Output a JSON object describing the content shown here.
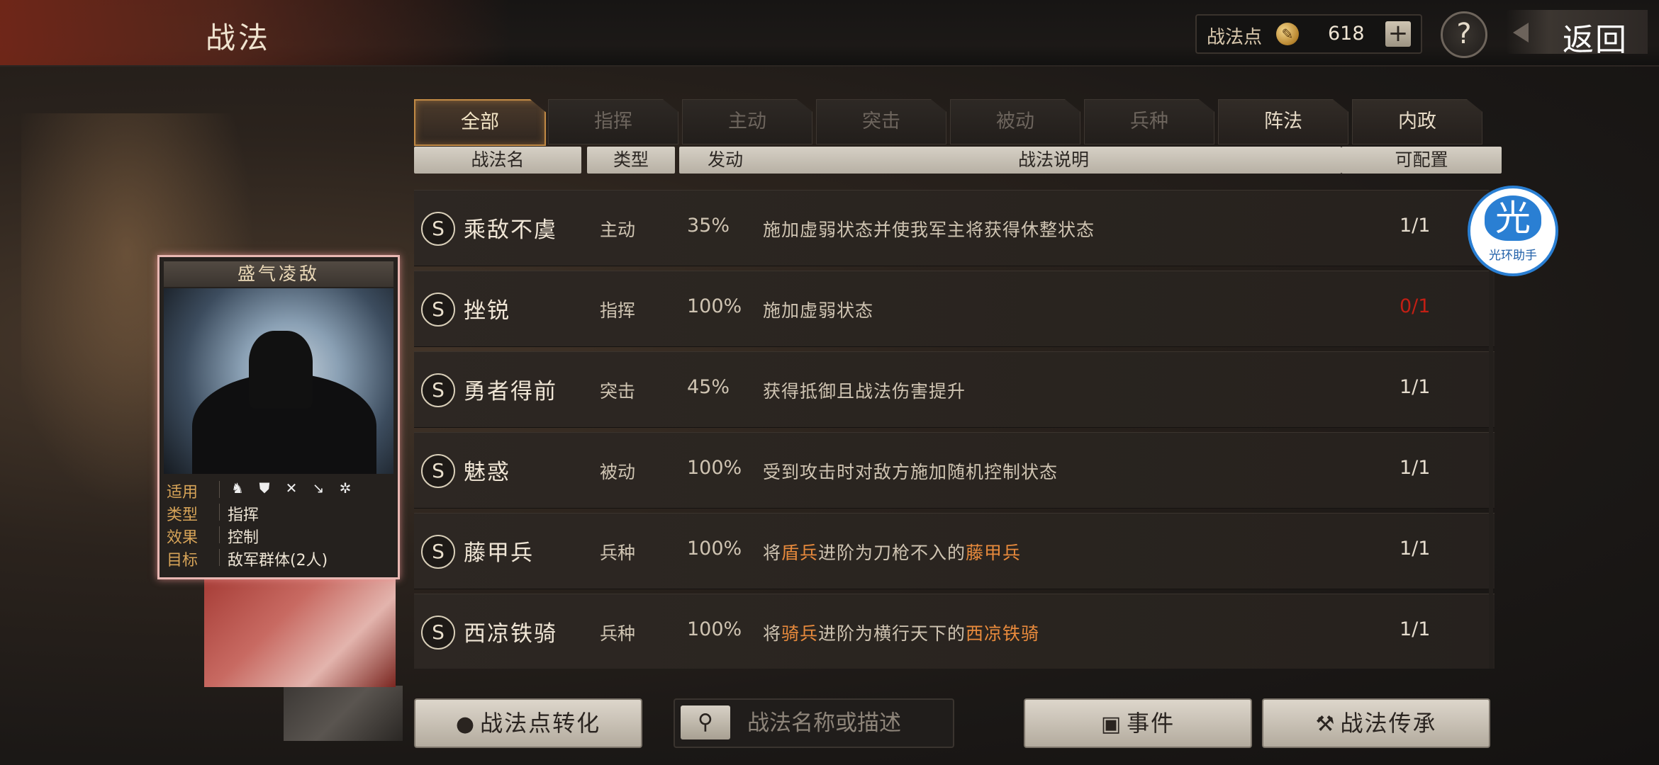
{
  "header": {
    "title": "战法",
    "points_label": "战法点",
    "points_value": "618",
    "plus_label": "+",
    "help_label": "?",
    "back_label": "返回"
  },
  "tabs": [
    {
      "label": "全部",
      "state": "active"
    },
    {
      "label": "指挥",
      "state": "dim"
    },
    {
      "label": "主动",
      "state": "dim"
    },
    {
      "label": "突击",
      "state": "dim"
    },
    {
      "label": "被动",
      "state": "dim"
    },
    {
      "label": "兵种",
      "state": "dim"
    },
    {
      "label": "阵法",
      "state": "bright"
    },
    {
      "label": "内政",
      "state": "bright"
    }
  ],
  "columns": {
    "name": "战法名",
    "type": "类型",
    "rate": "发动",
    "desc": "战法说明",
    "config": "可配置"
  },
  "rows": [
    {
      "grade": "S",
      "name": "乘敌不虞",
      "type": "主动",
      "rate": "35%",
      "desc_parts": [
        {
          "t": "施加虚弱状态并使我军主将获得休整状态"
        }
      ],
      "config": "1/1",
      "config_color": "normal"
    },
    {
      "grade": "S",
      "name": "挫锐",
      "type": "指挥",
      "rate": "100%",
      "desc_parts": [
        {
          "t": "施加虚弱状态"
        }
      ],
      "config": "0/1",
      "config_color": "red"
    },
    {
      "grade": "S",
      "name": "勇者得前",
      "type": "突击",
      "rate": "45%",
      "desc_parts": [
        {
          "t": "获得抵御且战法伤害提升"
        }
      ],
      "config": "1/1",
      "config_color": "normal"
    },
    {
      "grade": "S",
      "name": "魅惑",
      "type": "被动",
      "rate": "100%",
      "desc_parts": [
        {
          "t": "受到攻击时对敌方施加随机控制状态"
        }
      ],
      "config": "1/1",
      "config_color": "normal"
    },
    {
      "grade": "S",
      "name": "藤甲兵",
      "type": "兵种",
      "rate": "100%",
      "desc_parts": [
        {
          "t": "将"
        },
        {
          "t": "盾兵",
          "hl": true
        },
        {
          "t": "进阶为刀枪不入的"
        },
        {
          "t": "藤甲兵",
          "hl": true
        }
      ],
      "config": "1/1",
      "config_color": "normal"
    },
    {
      "grade": "S",
      "name": "西凉铁骑",
      "type": "兵种",
      "rate": "100%",
      "desc_parts": [
        {
          "t": "将"
        },
        {
          "t": "骑兵",
          "hl": true
        },
        {
          "t": "进阶为横行天下的"
        },
        {
          "t": "西凉铁骑",
          "hl": true
        }
      ],
      "config": "1/1",
      "config_color": "normal"
    }
  ],
  "card": {
    "title": "盛气凌敌",
    "apply_label": "适用",
    "apply_icons": [
      "cavalry-icon",
      "shield-icon",
      "bow-icon",
      "spear-icon",
      "chariot-icon"
    ],
    "type_label": "类型",
    "type_value": "指挥",
    "effect_label": "效果",
    "effect_value": "控制",
    "target_label": "目标",
    "target_value": "敌军群体(2人)"
  },
  "bottom": {
    "convert_label": "战法点转化",
    "search_placeholder": "战法名称或描述",
    "events_label": "事件",
    "inherit_label": "战法传承"
  },
  "watermark": {
    "glyph": "光",
    "text": "光环助手"
  },
  "colors": {
    "highlight": "#e88a3c",
    "red": "#c21f14",
    "tab_active_border": "#c28a45"
  }
}
